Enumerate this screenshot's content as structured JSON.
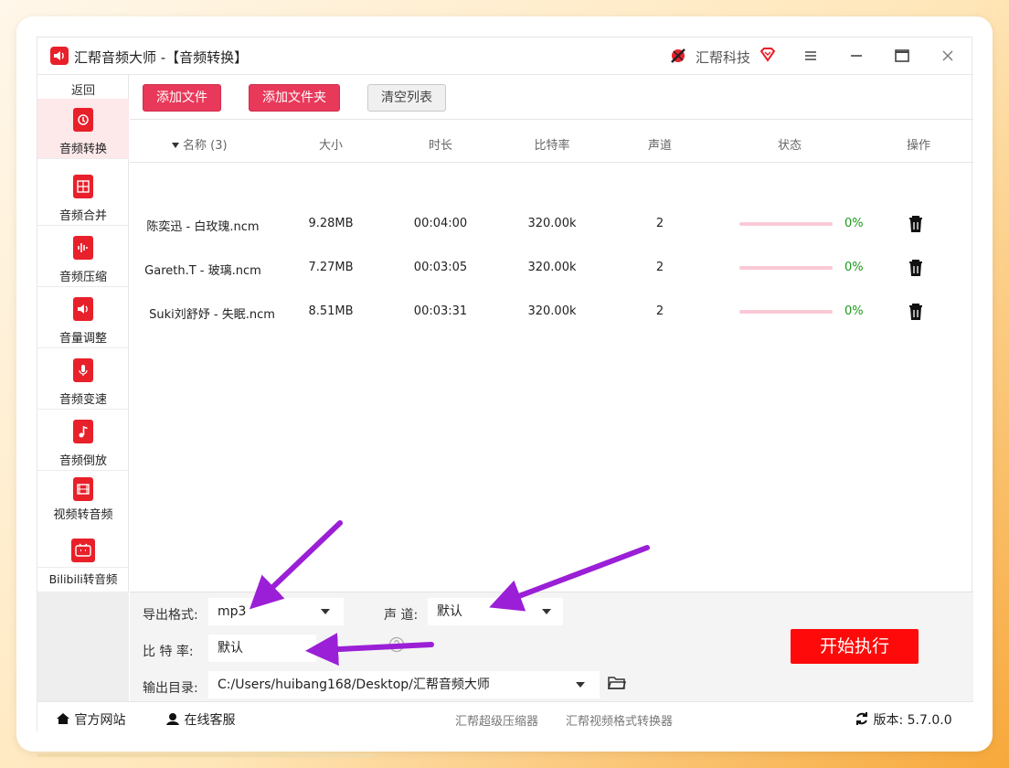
{
  "window": {
    "title": "汇帮音频大师 -【音频转换】",
    "brand": "汇帮科技"
  },
  "sidebar": {
    "back_label": "返回",
    "items": [
      {
        "label": "音频转换",
        "icon": "audio-convert-icon",
        "active": true
      },
      {
        "label": "音频合并",
        "icon": "audio-merge-icon"
      },
      {
        "label": "音频压缩",
        "icon": "audio-compress-icon"
      },
      {
        "label": "音量调整",
        "icon": "volume-adjust-icon"
      },
      {
        "label": "音频变速",
        "icon": "audio-speed-icon"
      },
      {
        "label": "音频倒放",
        "icon": "audio-reverse-icon"
      },
      {
        "label": "视频转音频",
        "icon": "video-to-audio-icon"
      },
      {
        "label": "Bilibili转音频",
        "icon": "bilibili-icon"
      }
    ]
  },
  "toolbar": {
    "add_file": "添加文件",
    "add_folder": "添加文件夹",
    "clear_list": "清空列表"
  },
  "table": {
    "columns": [
      "名称 (3)",
      "大小",
      "时长",
      "比特率",
      "声道",
      "状态",
      "操作"
    ],
    "rows": [
      {
        "name": "陈奕迅 - 白玫瑰.ncm",
        "size": "9.28MB",
        "duration": "00:04:00",
        "bitrate": "320.00k",
        "channels": "2",
        "progress": 0,
        "status": "0%"
      },
      {
        "name": "Gareth.T - 玻璃.ncm",
        "size": "7.27MB",
        "duration": "00:03:05",
        "bitrate": "320.00k",
        "channels": "2",
        "progress": 0,
        "status": "0%"
      },
      {
        "name": "Suki刘舒妤 - 失眠.ncm",
        "size": "8.51MB",
        "duration": "00:03:31",
        "bitrate": "320.00k",
        "channels": "2",
        "progress": 0,
        "status": "0%"
      }
    ]
  },
  "settings": {
    "format_label": "导出格式:",
    "format_value": "mp3",
    "channel_label": "声 道:",
    "channel_value": "默认",
    "bitrate_label": "比 特 率:",
    "bitrate_value": "默认",
    "output_label": "输出目录:",
    "output_value": "C:/Users/huibang168/Desktop/汇帮音频大师",
    "start_button": "开始执行"
  },
  "footer": {
    "website": "官方网站",
    "support": "在线客服",
    "link1": "汇帮超级压缩器",
    "link2": "汇帮视频格式转换器",
    "version": "版本: 5.7.0.0"
  },
  "colors": {
    "accent": "#e8395a",
    "brand_red": "#e8202a",
    "start_button": "#ff0a0a",
    "annotation_arrow": "#9b1fd6",
    "status_text": "#1a9a1a"
  }
}
